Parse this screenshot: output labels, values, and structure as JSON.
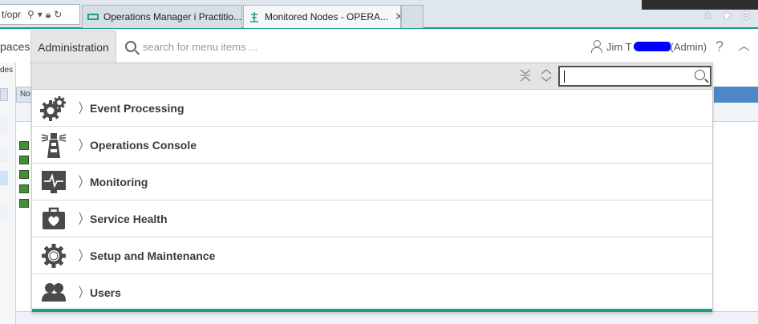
{
  "browser": {
    "address_fragment": "t/opr",
    "tabs": [
      {
        "label": "Operations Manager i Practitio...",
        "active": false
      },
      {
        "label": "Monitored Nodes - OPERA...",
        "active": true
      }
    ],
    "tab_close_symbol": "✕",
    "icons": [
      "home-icon",
      "star-icon",
      "gear-icon"
    ]
  },
  "header": {
    "nav_partial": "paces",
    "nav_admin": "Administration",
    "search_placeholder": "search for menu items ...",
    "user_first": "Jim T",
    "user_role": "(Admin)",
    "help": "?"
  },
  "background": {
    "left_label": "des",
    "table_header": "No"
  },
  "menu": {
    "filter_value": "",
    "items": [
      {
        "label": "Event Processing",
        "icon": "gears-icon"
      },
      {
        "label": "Operations Console",
        "icon": "lighthouse-icon"
      },
      {
        "label": "Monitoring",
        "icon": "heartbeat-monitor-icon"
      },
      {
        "label": "Service Health",
        "icon": "medical-case-icon"
      },
      {
        "label": "Setup and Maintenance",
        "icon": "gear-icon"
      },
      {
        "label": "Users",
        "icon": "users-icon"
      }
    ]
  },
  "colors": {
    "accent": "#15a28a",
    "redaction": "#0000ff",
    "icon_gray": "#4a4a4a"
  }
}
